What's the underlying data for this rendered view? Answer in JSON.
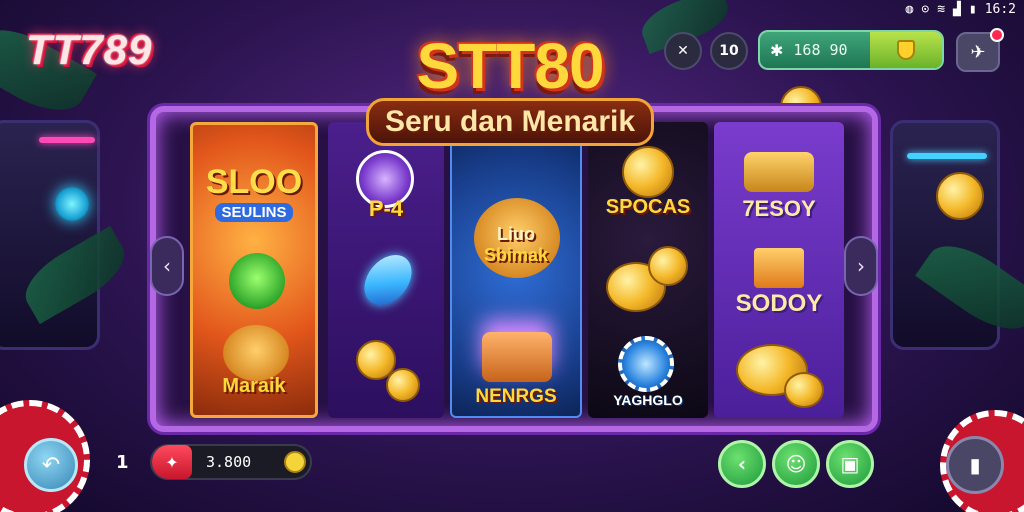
{
  "status_bar": {
    "time": "16:2"
  },
  "brand": {
    "logo": "TT789"
  },
  "top_controls": {
    "settings_label": "✕",
    "level_label": "10",
    "balance": "168 90"
  },
  "banner": {
    "title": "STT80",
    "subtitle": "Seru dan Menarik"
  },
  "reels": [
    {
      "symbols": [
        "SLOO",
        "SEULINS",
        "Maraik"
      ]
    },
    {
      "symbols": [
        "P-4"
      ]
    },
    {
      "symbols": [
        "Liuo",
        "Sbimak",
        "NENRGS"
      ]
    },
    {
      "symbols": [
        "SPOCAS",
        "YAGHGLO"
      ]
    },
    {
      "symbols": [
        "7ESOY",
        "SODOY"
      ]
    }
  ],
  "bottom_bar": {
    "level": "1",
    "bet_value": "3.800"
  },
  "colors": {
    "accent": "#b468e3",
    "gold": "#ffd93b",
    "green": "#1f9a3c",
    "red": "#c7162d"
  },
  "icons": {
    "back": "back-arrow-icon",
    "share": "share-icon",
    "chat": "chat-icon",
    "screen": "screen-icon",
    "lock": "lock-icon",
    "plane": "plane-icon",
    "shield": "shield-icon"
  }
}
